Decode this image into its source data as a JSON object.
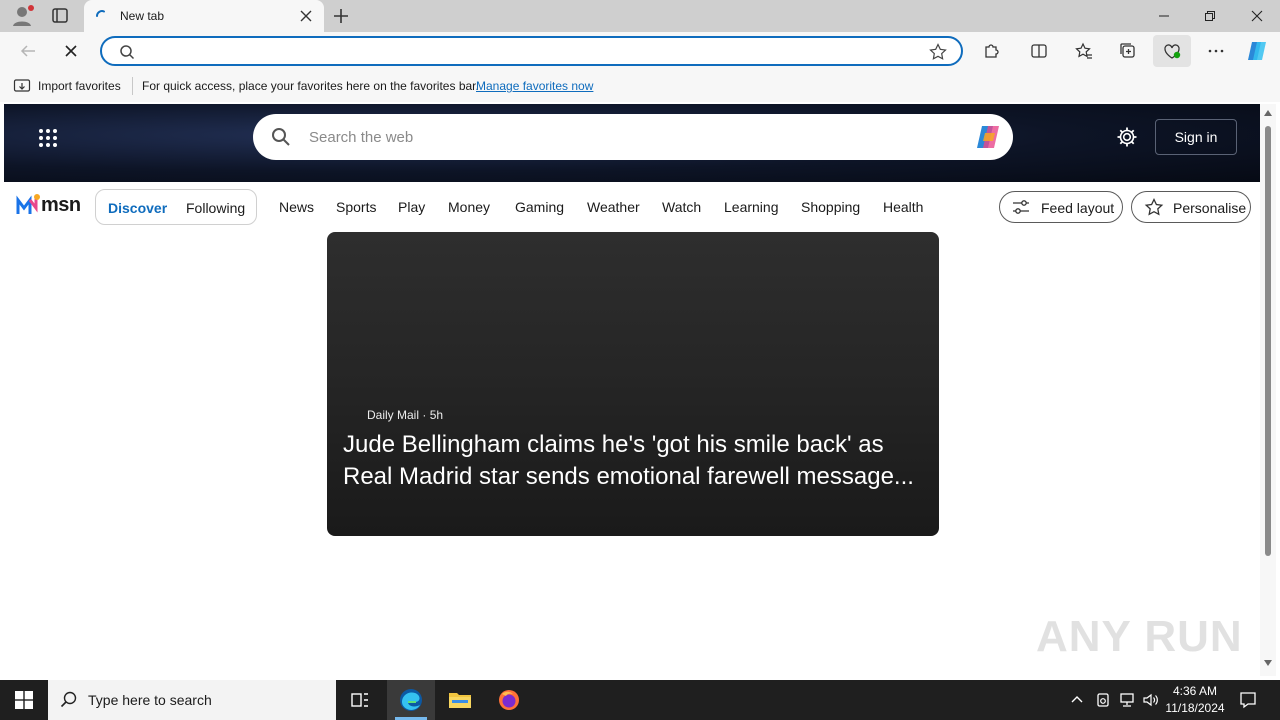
{
  "browser": {
    "tab_title": "New tab",
    "address_value": "",
    "favorites_bar": {
      "import_label": "Import favorites",
      "hint": "For quick access, place your favorites here on the favorites bar.",
      "manage_link": "Manage favorites now"
    }
  },
  "msn": {
    "search_placeholder": "Search the web",
    "sign_in": "Sign in",
    "logo_text": "msn",
    "segments": [
      "Discover",
      "Following"
    ],
    "nav_items": [
      "News",
      "Sports",
      "Play",
      "Money",
      "Gaming",
      "Weather",
      "Watch",
      "Learning",
      "Shopping",
      "Health"
    ],
    "feed_layout": "Feed layout",
    "personalise": "Personalise",
    "card": {
      "source": "Daily Mail",
      "age": "5h",
      "title": "Jude Bellingham claims he's 'got his smile back' as Real Madrid star sends emotional farewell message..."
    }
  },
  "watermark": "ANY RUN",
  "taskbar": {
    "search_placeholder": "Type here to search",
    "time": "4:36 AM",
    "date": "11/18/2024"
  },
  "colors": {
    "accent": "#0f6cbd",
    "tab_strip": "#cfcfcf",
    "toolbar": "#f7f7f7",
    "taskbar": "#1f1f1f"
  }
}
